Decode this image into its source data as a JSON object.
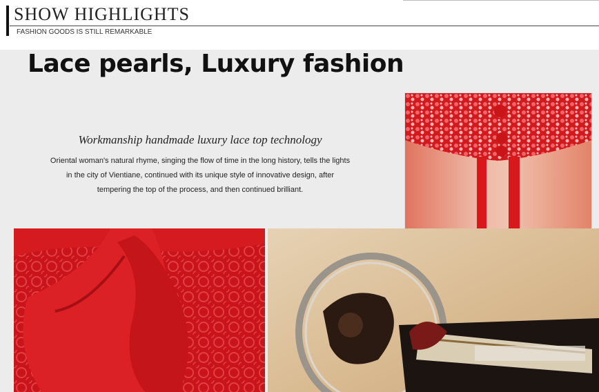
{
  "header": {
    "title": "SHOW HIGHLIGHTS",
    "subtitle": "FASHION GOODS IS STILL REMARKABLE"
  },
  "feature": {
    "headline": "Lace pearls, Luxury fashion",
    "tagline": "Workmanship handmade luxury lace top technology",
    "description": "Oriental woman's natural rhyme, singing the flow of time in the long history, tells the lights in the city of Vientiane, continued with its unique style of innovative design, after tempering the top of the process, and then continued brilliant."
  },
  "photos": {
    "collar": "red-beaded-collar-photo",
    "bow": "red-lace-bow-photo",
    "machine": "vintage-sewing-machine-photo"
  },
  "colors": {
    "garment_red": "#d8161b",
    "background": "#ececec",
    "header_text": "#222222"
  }
}
